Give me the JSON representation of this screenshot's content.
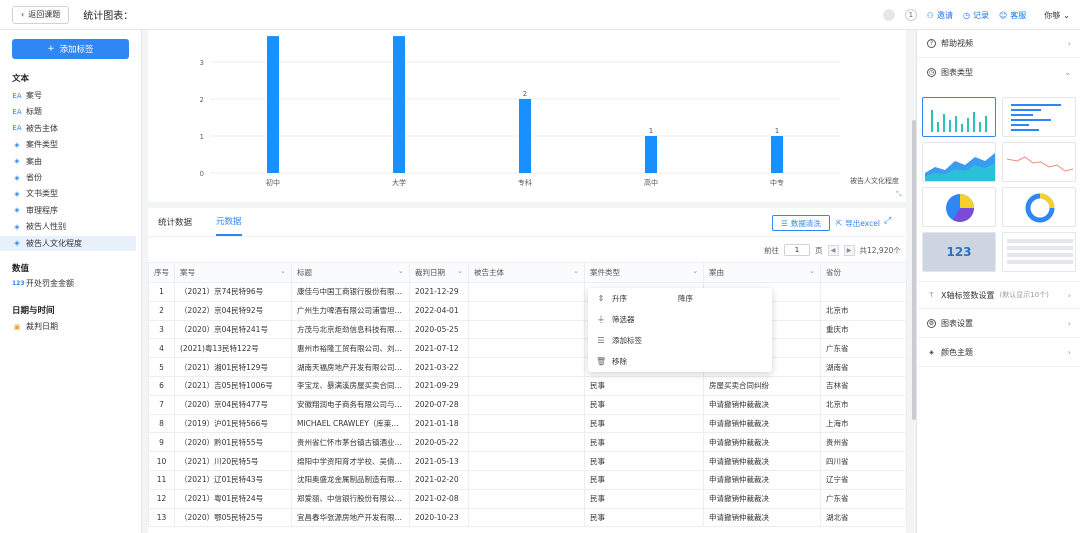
{
  "topbar": {
    "back_label": "返回课题",
    "title": "统计图表：",
    "badge_count": "1",
    "invite": "邀请",
    "record": "记录",
    "service": "客服",
    "user": "你够"
  },
  "sidebar": {
    "add_label": "添加标签",
    "text_group": "文本",
    "text_items": [
      "案号",
      "标题",
      "被告主体",
      "案件类型",
      "案由",
      "省份",
      "文书类型",
      "审理程序",
      "被告人性别",
      "被告人文化程度"
    ],
    "number_group": "数值",
    "number_items": [
      "开处罚金金额"
    ],
    "date_group": "日期与时间",
    "date_items": [
      "裁判日期"
    ]
  },
  "chart_data": {
    "type": "bar",
    "categories": [
      "初中",
      "大学",
      "专科",
      "高中",
      "中专"
    ],
    "values": [
      3.7,
      3.7,
      2,
      1,
      1
    ],
    "data_labels": [
      "",
      "",
      "2",
      "1",
      "1"
    ],
    "ylim": [
      0,
      3.7
    ],
    "yticks": [
      "0",
      "1",
      "2",
      "3"
    ],
    "xlabel": "被告人文化程度",
    "color": "#1890ff",
    "grid": true
  },
  "data": {
    "tab_stats": "统计数据",
    "tab_meta": "元数据",
    "clean_btn": "数据清洗",
    "export_btn": "导出excel",
    "pager": {
      "prefix": "前往",
      "page": "1",
      "suffix": "页",
      "total": "共12,920个"
    },
    "columns": [
      "序号",
      "案号",
      "标题",
      "裁判日期",
      "被告主体",
      "案件类型",
      "案由",
      "省份"
    ],
    "rows": [
      [
        "1",
        "（2021）京74民特96号",
        "康佳与中国工商银行股份有限公...",
        "2021-12-29",
        "",
        "",
        "",
        ""
      ],
      [
        "2",
        "（2022）京04民特92号",
        "广州生力啤酒有限公司浦雪坦与...",
        "2022-04-01",
        "",
        "",
        "",
        "北京市"
      ],
      [
        "3",
        "（2020）京04民特241号",
        "方茂与北京炬劲信息科技有限公...",
        "2020-05-25",
        "",
        "",
        "",
        "重庆市"
      ],
      [
        "4",
        "(2021)粤13民特122号",
        "惠州市裕隆工贸有限公司、刘春...",
        "2021-07-12",
        "",
        "",
        "",
        "广东省"
      ],
      [
        "5",
        "（2021）湘01民特129号",
        "湖南天福房地产开发有限公司、...",
        "2021-03-22",
        "",
        "",
        "",
        "湖南省"
      ],
      [
        "6",
        "（2021）吉05民特1006号",
        "李宝龙、暴满溪房屋买卖合同纠...",
        "2021-09-29",
        "",
        "民事",
        "房屋买卖合同纠纷",
        "吉林省"
      ],
      [
        "7",
        "（2020）京04民特477号",
        "安徽翔润电子商务有限公司与庄...",
        "2020-07-28",
        "",
        "民事",
        "申请撤销仲裁裁决",
        "北京市"
      ],
      [
        "8",
        "（2019）沪01民特566号",
        "MICHAEL CRAWLEY（库莱利...",
        "2021-01-18",
        "",
        "民事",
        "申请撤销仲裁裁决",
        "上海市"
      ],
      [
        "9",
        "（2020）黔01民特55号",
        "贵州省仁怀市茅台镇古镇酒业有...",
        "2020-05-22",
        "",
        "民事",
        "申请撤销仲裁裁决",
        "贵州省"
      ],
      [
        "10",
        "（2021）川20民特5号",
        "绵阳中学资阳育才学校、吴倩申...",
        "2021-05-13",
        "",
        "民事",
        "申请撤销仲裁裁决",
        "四川省"
      ],
      [
        "11",
        "（2021）辽01民特43号",
        "沈阳奥盛龙金属制品制造有限公...",
        "2021-02-20",
        "",
        "民事",
        "申请撤销仲裁裁决",
        "辽宁省"
      ],
      [
        "12",
        "（2021）粤01民特24号",
        "郑爱丽、中信银行股份有限公司...",
        "2021-02-08",
        "",
        "民事",
        "申请撤销仲裁裁决",
        "广东省"
      ],
      [
        "13",
        "（2020）鄂05民特25号",
        "宜昌春华张源房地产开发有限公...",
        "2020-10-23",
        "",
        "民事",
        "申请撤销仲裁裁决",
        "湖北省"
      ]
    ],
    "menu": {
      "asc": "升序",
      "desc": "降序",
      "filter": "筛选器",
      "add_tag": "添加标签",
      "remove": "移除"
    }
  },
  "right_panel": {
    "help": "帮助视频",
    "chart_type": "图表类型",
    "thumb_number": "123",
    "x_axis": "X轴标签数设置",
    "x_axis_hint": "(默认显示10个)",
    "chart_settings": "图表设置",
    "color_theme": "颜色主题"
  }
}
